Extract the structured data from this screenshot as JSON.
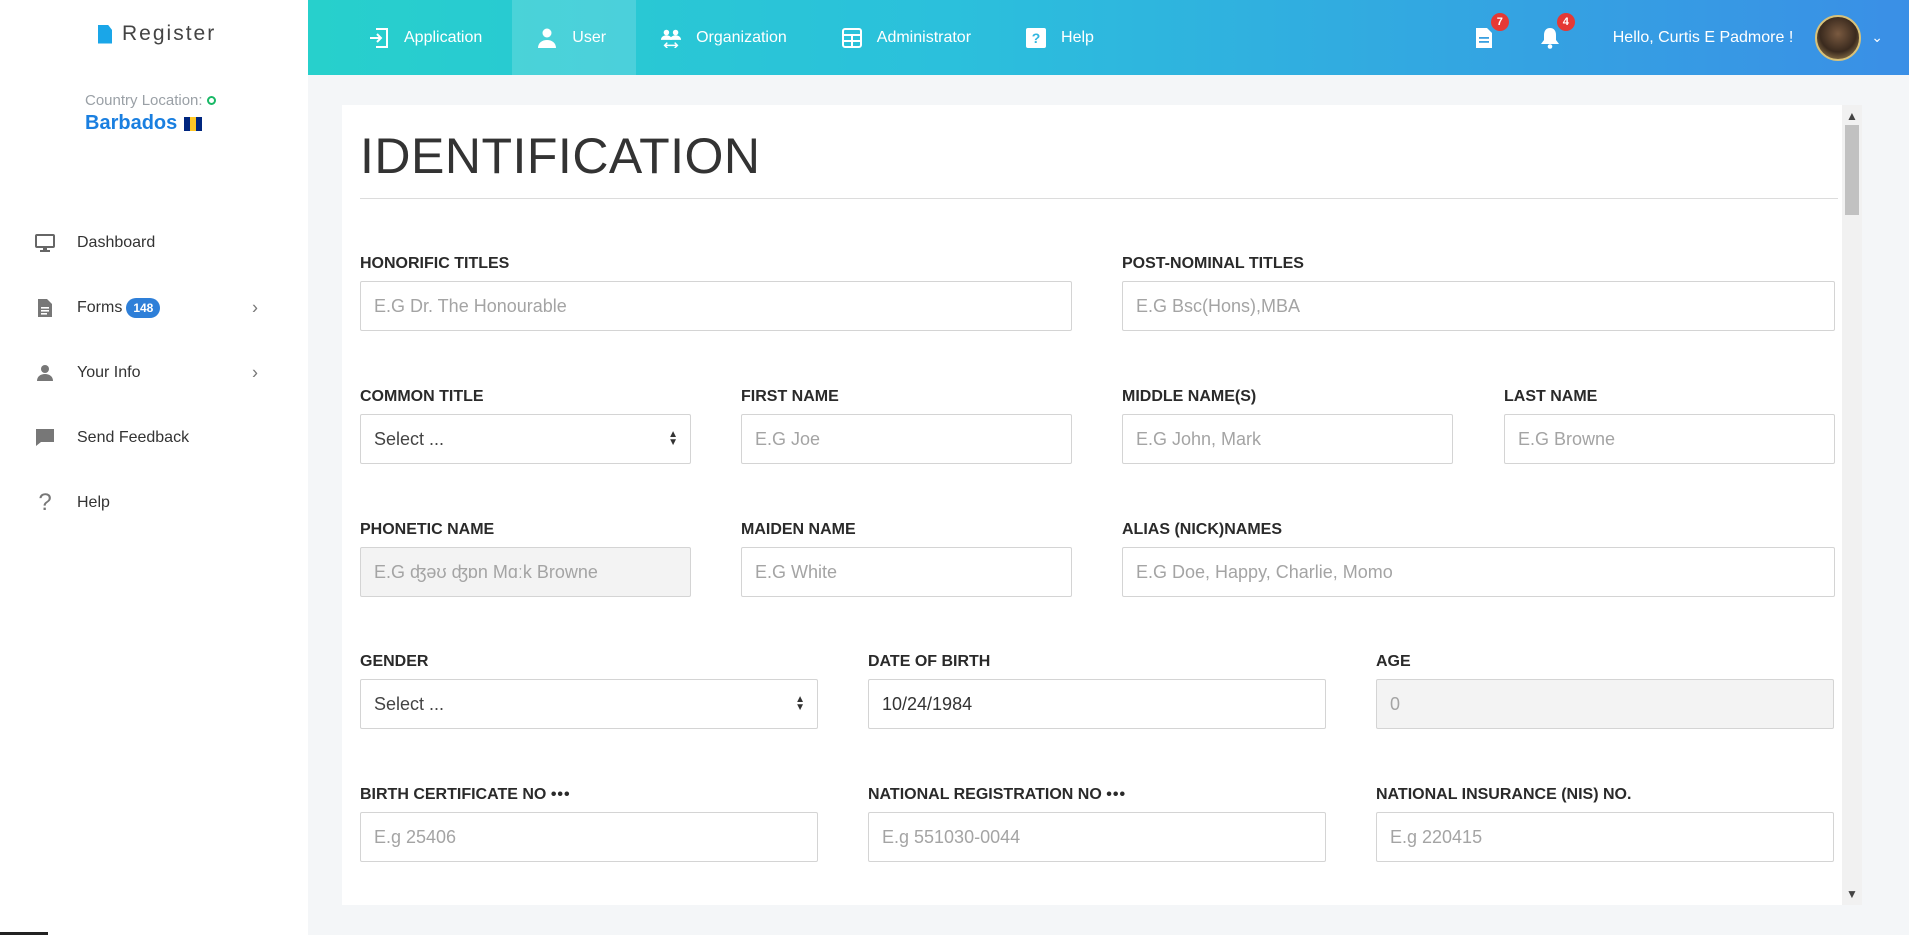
{
  "brand": {
    "name": "Register"
  },
  "location": {
    "label": "Country Location:",
    "country": "Barbados",
    "flag_colors": [
      "#00267F",
      "#FFC726",
      "#00267F"
    ]
  },
  "sidebar": {
    "items": [
      {
        "label": "Dashboard",
        "icon": "monitor-icon"
      },
      {
        "label": "Forms",
        "icon": "document-icon",
        "badge": "148",
        "has_chevron": true
      },
      {
        "label": "Your Info",
        "icon": "person-icon",
        "has_chevron": true
      },
      {
        "label": "Send Feedback",
        "icon": "chat-icon"
      },
      {
        "label": "Help",
        "icon": "question-icon"
      }
    ]
  },
  "topnav": {
    "items": [
      {
        "label": "Application",
        "icon": "login-icon"
      },
      {
        "label": "User",
        "icon": "user-icon",
        "active": true
      },
      {
        "label": "Organization",
        "icon": "group-icon"
      },
      {
        "label": "Administrator",
        "icon": "grid-icon"
      },
      {
        "label": "Help",
        "icon": "question-box-icon"
      }
    ],
    "documents_count": "7",
    "notifications_count": "4",
    "greeting": "Hello, Curtis E Padmore !"
  },
  "form": {
    "title": "IDENTIFICATION",
    "fields": {
      "honorific": {
        "label": "HONORIFIC TITLES",
        "placeholder": "E.G Dr. The Honourable"
      },
      "post_nominal": {
        "label": "POST-NOMINAL TITLES",
        "placeholder": "E.G Bsc(Hons),MBA"
      },
      "common_title": {
        "label": "COMMON TITLE",
        "value": "Select ..."
      },
      "first_name": {
        "label": "FIRST NAME",
        "placeholder": "E.G Joe"
      },
      "middle_name": {
        "label": "MIDDLE NAME(S)",
        "placeholder": "E.G John, Mark"
      },
      "last_name": {
        "label": "LAST NAME",
        "placeholder": "E.G Browne"
      },
      "phonetic": {
        "label": "PHONETIC NAME",
        "placeholder": "E.G ʤəʊ ʤɒn Mɑːk Browne"
      },
      "maiden": {
        "label": "MAIDEN NAME",
        "placeholder": "E.G White"
      },
      "alias": {
        "label": "ALIAS (NICK)NAMES",
        "placeholder": "E.G Doe, Happy, Charlie, Momo"
      },
      "gender": {
        "label": "GENDER",
        "value": "Select ..."
      },
      "dob": {
        "label": "DATE OF BIRTH",
        "value": "10/24/1984"
      },
      "age": {
        "label": "AGE",
        "placeholder": "0"
      },
      "birth_cert": {
        "label": "BIRTH CERTIFICATE NO",
        "suffix": "•••",
        "placeholder": "E.g 25406"
      },
      "national_reg": {
        "label": "NATIONAL REGISTRATION NO",
        "suffix": "•••",
        "placeholder": "E.g 551030-0044"
      },
      "nis": {
        "label": "NATIONAL INSURANCE (NIS) NO.",
        "placeholder": "E.g 220415"
      }
    }
  }
}
